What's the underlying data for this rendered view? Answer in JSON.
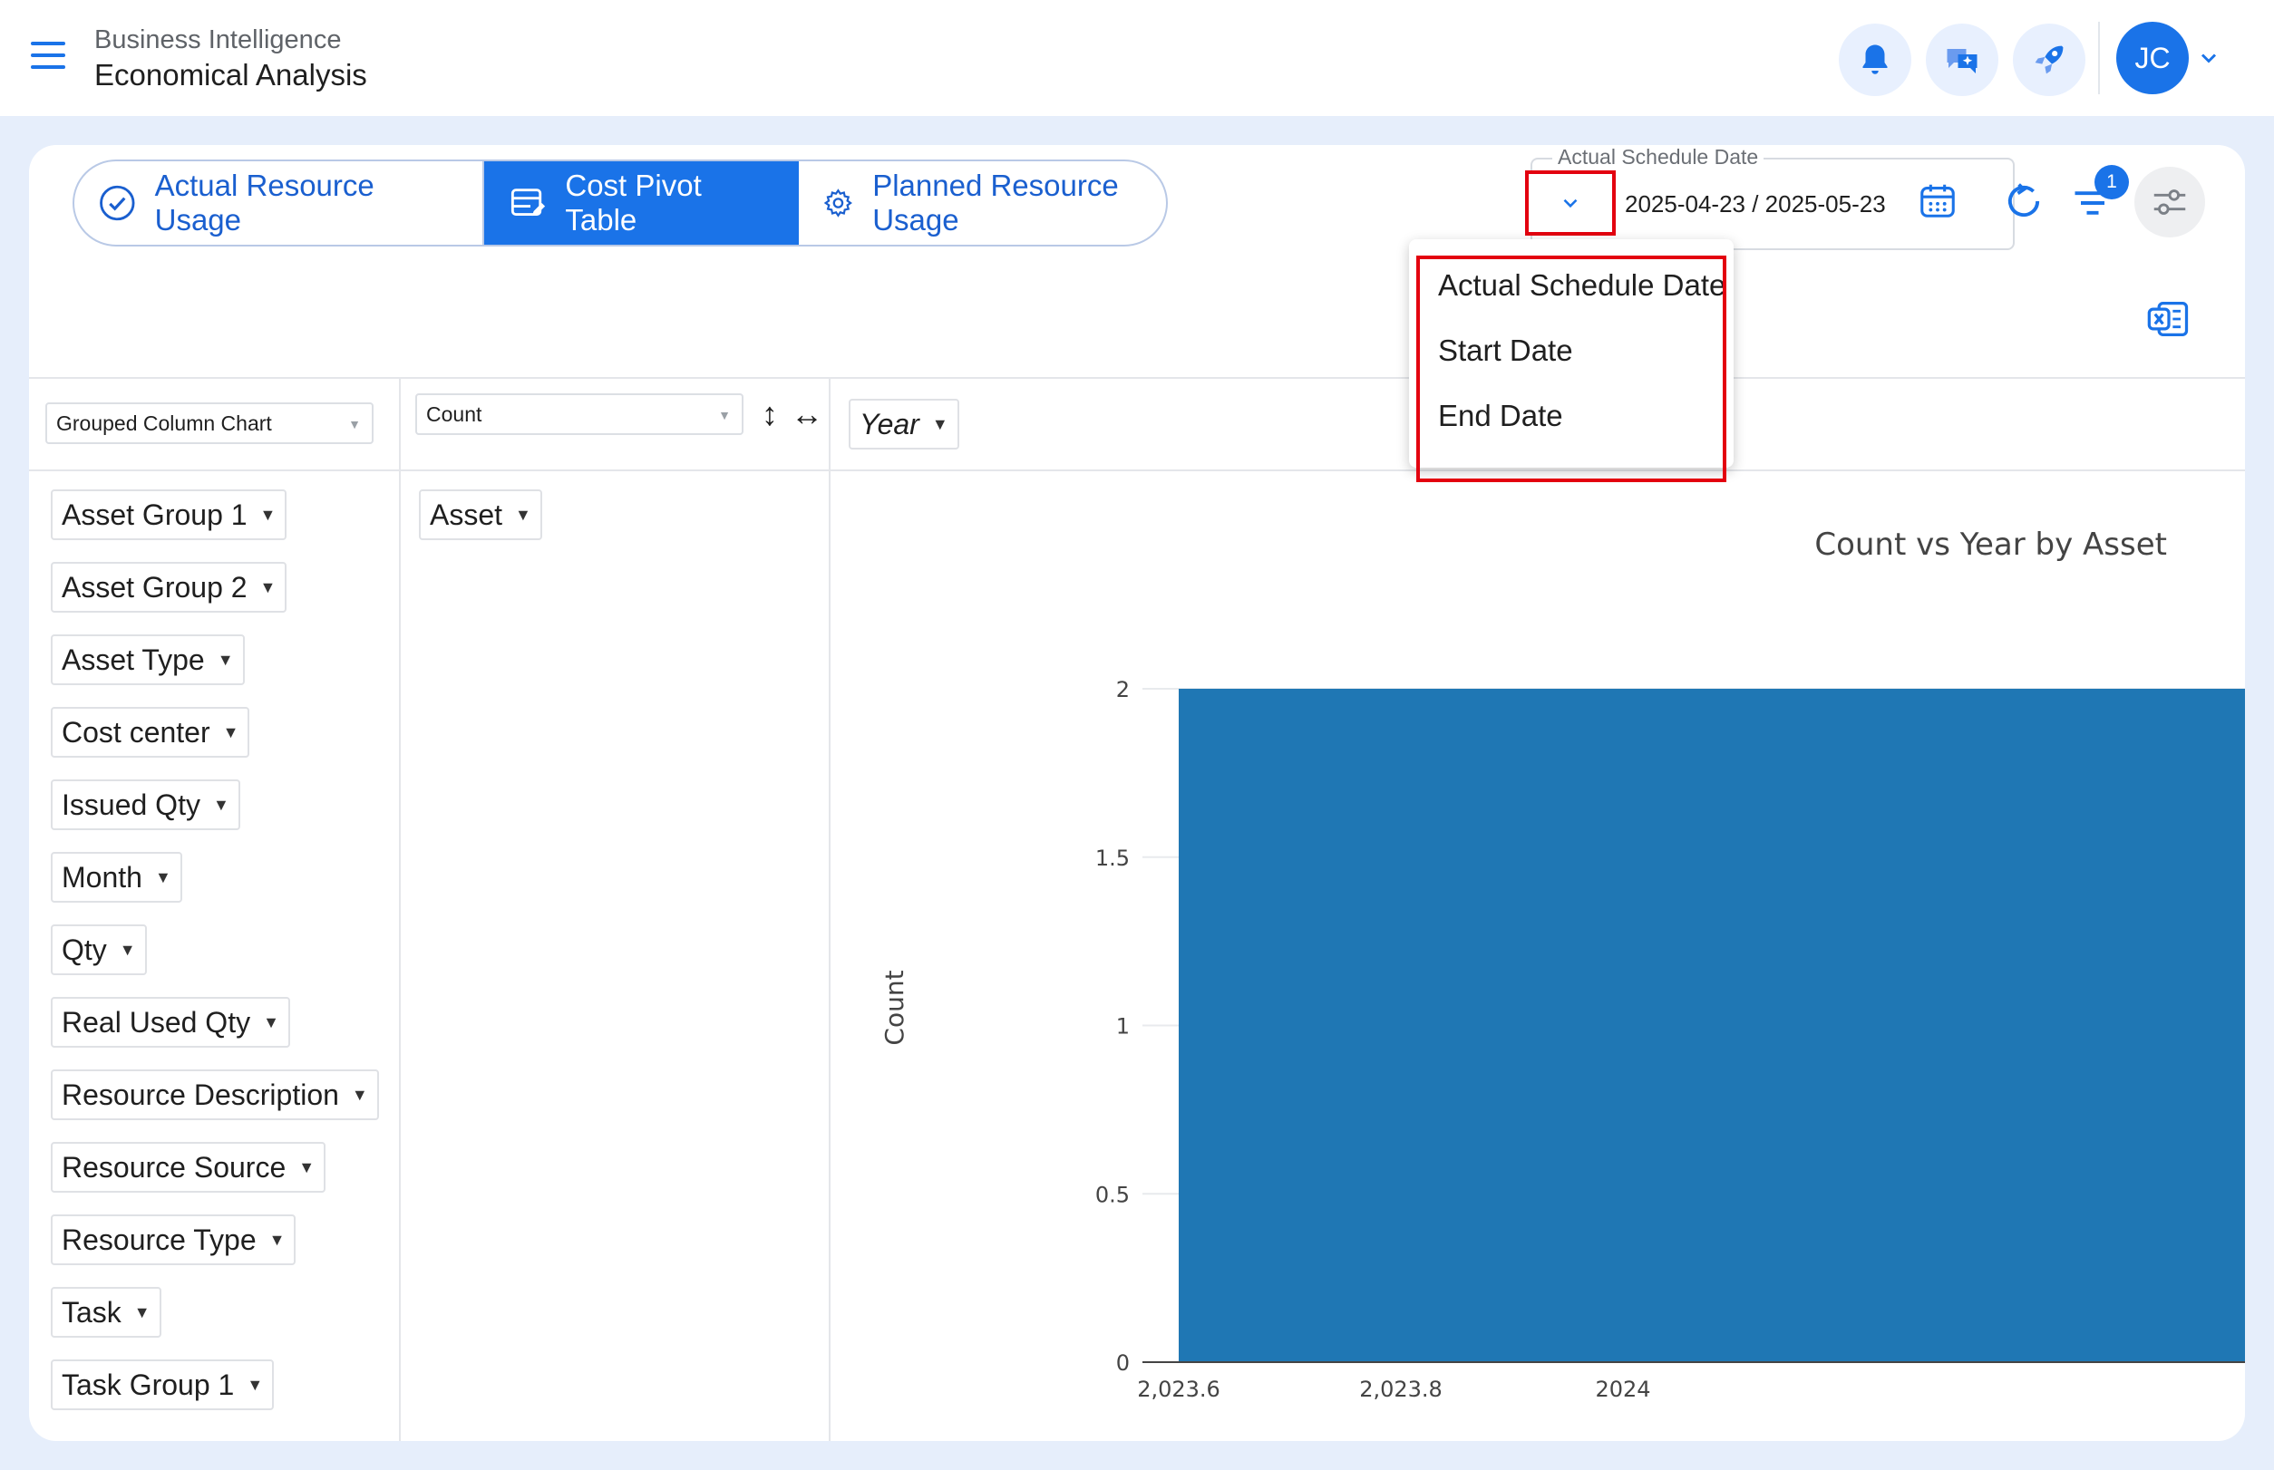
{
  "header": {
    "subtitle": "Business Intelligence",
    "title": "Economical Analysis",
    "avatar_initials": "JC"
  },
  "tabs": [
    {
      "label": "Actual Resource Usage",
      "icon": "check-circle-icon"
    },
    {
      "label": "Cost Pivot Table",
      "icon": "table-edit-icon",
      "active": true
    },
    {
      "label": "Planned Resource Usage",
      "icon": "gear-icon"
    }
  ],
  "date_filter": {
    "label": "Actual Schedule Date",
    "value": "2025-04-23 / 2025-05-23",
    "options": [
      "Actual Schedule Date",
      "Start Date",
      "End Date"
    ]
  },
  "filter_badge": "1",
  "pivot": {
    "renderer": "Grouped Column Chart",
    "aggregator": "Count",
    "col_attr": "Year",
    "row_attr": "Asset",
    "attributes": [
      "Asset Group 1",
      "Asset Group 2",
      "Asset Type",
      "Cost center",
      "Issued Qty",
      "Month",
      "Qty",
      "Real Used Qty",
      "Resource Description",
      "Resource Source",
      "Resource Type",
      "Task",
      "Task Group 1"
    ]
  },
  "chart_data": {
    "type": "bar",
    "title": "Count vs Year by Asset",
    "ylabel": "Count",
    "xlabel": "",
    "x_tick_labels": [
      "2,023.6",
      "2,023.8",
      "2024"
    ],
    "y_tick_labels": [
      "0",
      "0.5",
      "1",
      "1.5",
      "2"
    ],
    "xlim": [
      2023.6,
      2024.56
    ],
    "ylim": [
      0,
      2
    ],
    "bars": [
      {
        "x_start": 2023.6,
        "x_end": 2024.56,
        "value": 2
      }
    ],
    "bar_color": "#1f77b4"
  }
}
